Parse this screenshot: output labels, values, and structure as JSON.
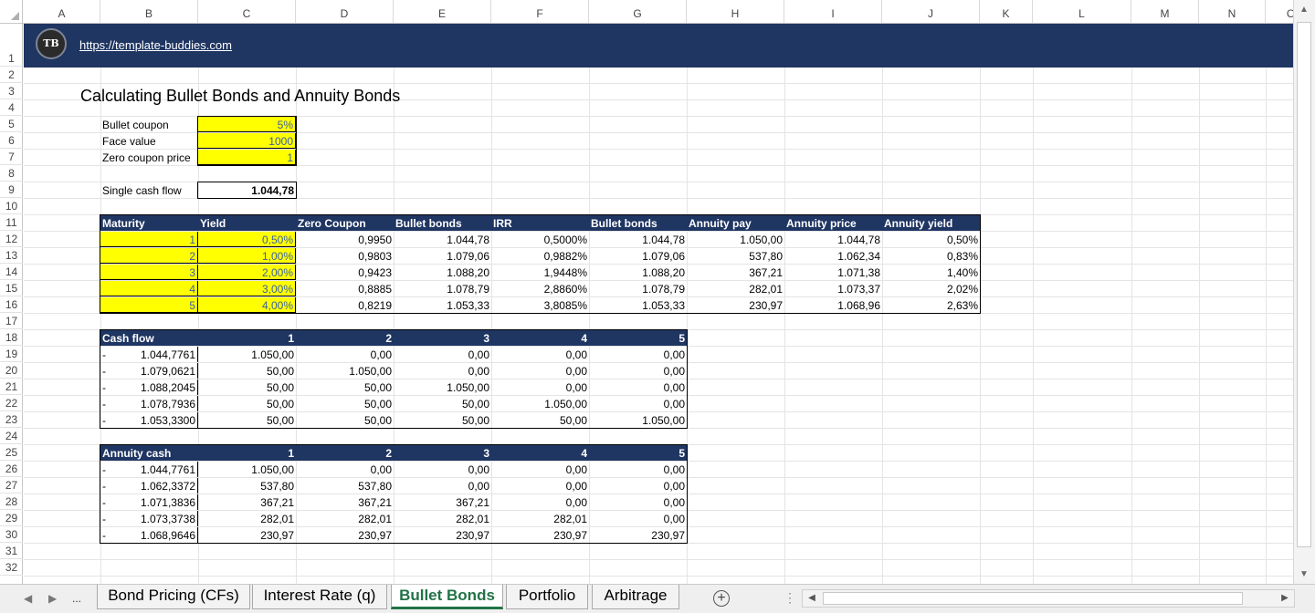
{
  "columns": [
    "A",
    "B",
    "C",
    "D",
    "E",
    "F",
    "G",
    "H",
    "I",
    "J",
    "K",
    "L",
    "M",
    "N",
    "O"
  ],
  "rows": [
    "1",
    "2",
    "3",
    "4",
    "5",
    "6",
    "7",
    "8",
    "9",
    "10",
    "11",
    "12",
    "13",
    "14",
    "15",
    "16",
    "17",
    "18",
    "19",
    "20",
    "21",
    "22",
    "23",
    "24",
    "25",
    "26",
    "27",
    "28",
    "29",
    "30",
    "31",
    "32"
  ],
  "banner": {
    "logo_text": "TB",
    "url": "https://template-buddies.com"
  },
  "title": "Calculating Bullet Bonds and Annuity Bonds",
  "inputs": [
    {
      "label": "Bullet coupon",
      "value": "5%"
    },
    {
      "label": "Face value",
      "value": "1000"
    },
    {
      "label": "Zero coupon price",
      "value": "1"
    }
  ],
  "single_cash_flow": {
    "label": "Single cash flow",
    "value": "1.044,78"
  },
  "main_table": {
    "headers": [
      "Maturity",
      "Yield",
      "Zero Coupon",
      "Bullet bonds",
      "IRR",
      "Bullet bonds",
      "Annuity pay",
      "Annuity price",
      "Annuity yield"
    ],
    "rows": [
      [
        "1",
        "0,50%",
        "0,9950",
        "1.044,78",
        "0,5000%",
        "1.044,78",
        "1.050,00",
        "1.044,78",
        "0,50%"
      ],
      [
        "2",
        "1,00%",
        "0,9803",
        "1.079,06",
        "0,9882%",
        "1.079,06",
        "537,80",
        "1.062,34",
        "0,83%"
      ],
      [
        "3",
        "2,00%",
        "0,9423",
        "1.088,20",
        "1,9448%",
        "1.088,20",
        "367,21",
        "1.071,38",
        "1,40%"
      ],
      [
        "4",
        "3,00%",
        "0,8885",
        "1.078,79",
        "2,8860%",
        "1.078,79",
        "282,01",
        "1.073,37",
        "2,02%"
      ],
      [
        "5",
        "4,00%",
        "0,8219",
        "1.053,33",
        "3,8085%",
        "1.053,33",
        "230,97",
        "1.068,96",
        "2,63%"
      ]
    ]
  },
  "cash_flow_table": {
    "headers": [
      "Cash flow",
      "1",
      "2",
      "3",
      "4",
      "5"
    ],
    "rows": [
      [
        "-",
        "1.044,7761",
        "1.050,00",
        "0,00",
        "0,00",
        "0,00",
        "0,00"
      ],
      [
        "-",
        "1.079,0621",
        "50,00",
        "1.050,00",
        "0,00",
        "0,00",
        "0,00"
      ],
      [
        "-",
        "1.088,2045",
        "50,00",
        "50,00",
        "1.050,00",
        "0,00",
        "0,00"
      ],
      [
        "-",
        "1.078,7936",
        "50,00",
        "50,00",
        "50,00",
        "1.050,00",
        "0,00"
      ],
      [
        "-",
        "1.053,3300",
        "50,00",
        "50,00",
        "50,00",
        "50,00",
        "1.050,00"
      ]
    ]
  },
  "annuity_table": {
    "headers": [
      "Annuity cash",
      "1",
      "2",
      "3",
      "4",
      "5"
    ],
    "rows": [
      [
        "-",
        "1.044,7761",
        "1.050,00",
        "0,00",
        "0,00",
        "0,00",
        "0,00"
      ],
      [
        "-",
        "1.062,3372",
        "537,80",
        "537,80",
        "0,00",
        "0,00",
        "0,00"
      ],
      [
        "-",
        "1.071,3836",
        "367,21",
        "367,21",
        "367,21",
        "0,00",
        "0,00"
      ],
      [
        "-",
        "1.073,3738",
        "282,01",
        "282,01",
        "282,01",
        "282,01",
        "0,00"
      ],
      [
        "-",
        "1.068,9646",
        "230,97",
        "230,97",
        "230,97",
        "230,97",
        "230,97"
      ]
    ]
  },
  "sheet_tabs": [
    {
      "label": "Bond Pricing (CFs)",
      "active": false
    },
    {
      "label": "Interest Rate (q)",
      "active": false
    },
    {
      "label": "Bullet Bonds",
      "active": true
    },
    {
      "label": "Portfolio",
      "active": false
    },
    {
      "label": "Arbitrage",
      "active": false
    }
  ],
  "tab_nav": {
    "more": "..."
  },
  "colors": {
    "header_navy": "#1f3562",
    "input_yellow": "#ffff00",
    "input_text": "#385fa8",
    "active_tab": "#217346"
  }
}
